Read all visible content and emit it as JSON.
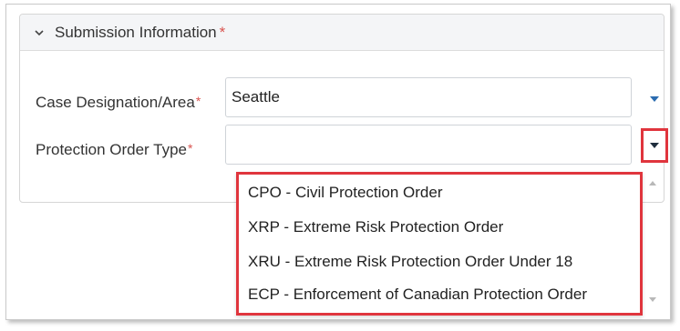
{
  "section": {
    "title": "Submission Information",
    "required_marker": "*"
  },
  "fields": {
    "case_area": {
      "label": "Case Designation/Area",
      "required_marker": "*",
      "value": "Seattle"
    },
    "order_type": {
      "label": "Protection Order Type",
      "required_marker": "*",
      "value": ""
    }
  },
  "dropdown": {
    "options": [
      "CPO - Civil Protection Order",
      "XRP - Extreme Risk Protection Order",
      "XRU - Extreme Risk Protection Order Under 18",
      "ECP - Enforcement of Canadian Protection Order"
    ]
  },
  "icons": {
    "collapse": "chevron-down-icon",
    "select": "caret-down-icon",
    "scroll_up": "scroll-up-icon",
    "scroll_down": "scroll-down-icon"
  },
  "colors": {
    "required": "#d9534f",
    "highlight": "#e0353d",
    "caret": "#2b6cb0",
    "header_bg": "#f4f5f7"
  }
}
